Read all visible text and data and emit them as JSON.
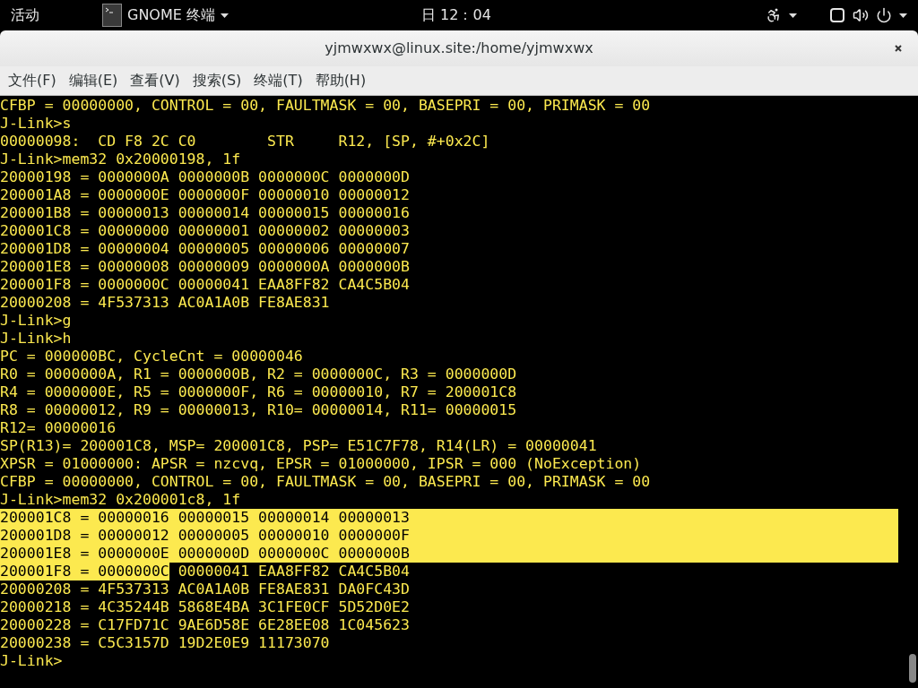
{
  "top_bar": {
    "activities": "活动",
    "app_menu": "GNOME 终端",
    "clock": "日 12：04"
  },
  "window": {
    "title": "yjmwxwx@linux.site:/home/yjmwxwx"
  },
  "menu": [
    "文件(F)",
    "编辑(E)",
    "查看(V)",
    "搜索(S)",
    "终端(T)",
    "帮助(H)"
  ],
  "terminal": {
    "lines": [
      {
        "text": "CFBP = 00000000, CONTROL = 00, FAULTMASK = 00, BASEPRI = 00, PRIMASK = 00",
        "selected": false
      },
      {
        "text": "J-Link>s",
        "selected": false
      },
      {
        "text": "00000098:  CD F8 2C C0        STR     R12, [SP, #+0x2C]",
        "selected": false
      },
      {
        "text": "J-Link>mem32 0x20000198, 1f",
        "selected": false
      },
      {
        "text": "20000198 = 0000000A 0000000B 0000000C 0000000D",
        "selected": false
      },
      {
        "text": "200001A8 = 0000000E 0000000F 00000010 00000012",
        "selected": false
      },
      {
        "text": "200001B8 = 00000013 00000014 00000015 00000016",
        "selected": false
      },
      {
        "text": "200001C8 = 00000000 00000001 00000002 00000003",
        "selected": false
      },
      {
        "text": "200001D8 = 00000004 00000005 00000006 00000007",
        "selected": false
      },
      {
        "text": "200001E8 = 00000008 00000009 0000000A 0000000B",
        "selected": false
      },
      {
        "text": "200001F8 = 0000000C 00000041 EAA8FF82 CA4C5B04",
        "selected": false
      },
      {
        "text": "20000208 = 4F537313 AC0A1A0B FE8AE831",
        "selected": false
      },
      {
        "text": "J-Link>g",
        "selected": false
      },
      {
        "text": "J-Link>h",
        "selected": false
      },
      {
        "text": "PC = 000000BC, CycleCnt = 00000046",
        "selected": false
      },
      {
        "text": "R0 = 0000000A, R1 = 0000000B, R2 = 0000000C, R3 = 0000000D",
        "selected": false
      },
      {
        "text": "R4 = 0000000E, R5 = 0000000F, R6 = 00000010, R7 = 200001C8",
        "selected": false
      },
      {
        "text": "R8 = 00000012, R9 = 00000013, R10= 00000014, R11= 00000015",
        "selected": false
      },
      {
        "text": "R12= 00000016",
        "selected": false
      },
      {
        "text": "SP(R13)= 200001C8, MSP= 200001C8, PSP= E51C7F78, R14(LR) = 00000041",
        "selected": false
      },
      {
        "text": "XPSR = 01000000: APSR = nzcvq, EPSR = 01000000, IPSR = 000 (NoException)",
        "selected": false
      },
      {
        "text": "CFBP = 00000000, CONTROL = 00, FAULTMASK = 00, BASEPRI = 00, PRIMASK = 00",
        "selected": false
      },
      {
        "text": "J-Link>mem32 0x200001c8, 1f",
        "selected": false
      },
      {
        "text": "200001C8 = 00000016 00000015 00000014 00000013",
        "selected": true
      },
      {
        "text": "200001D8 = 00000012 00000005 00000010 0000000F",
        "selected": true
      },
      {
        "text": "200001E8 = 0000000E 0000000D 0000000C 0000000B",
        "selected": true
      },
      {
        "segments": [
          {
            "text": "200001F8 = 0000000C",
            "selected": true
          },
          {
            "text": " 00000041 EAA8FF82 CA4C5B04",
            "selected": false
          }
        ]
      },
      {
        "text": "20000208 = 4F537313 AC0A1A0B FE8AE831 DA0FC43D",
        "selected": false
      },
      {
        "text": "20000218 = 4C35244B 5868E4BA 3C1FE0CF 5D52D0E2",
        "selected": false
      },
      {
        "text": "20000228 = C17FD71C 9AE6D58E 6E28EE08 1C045623",
        "selected": false
      },
      {
        "text": "20000238 = C5C3157D 19D2E0E9 11173070",
        "selected": false
      },
      {
        "text": "J-Link>",
        "selected": false
      }
    ]
  }
}
